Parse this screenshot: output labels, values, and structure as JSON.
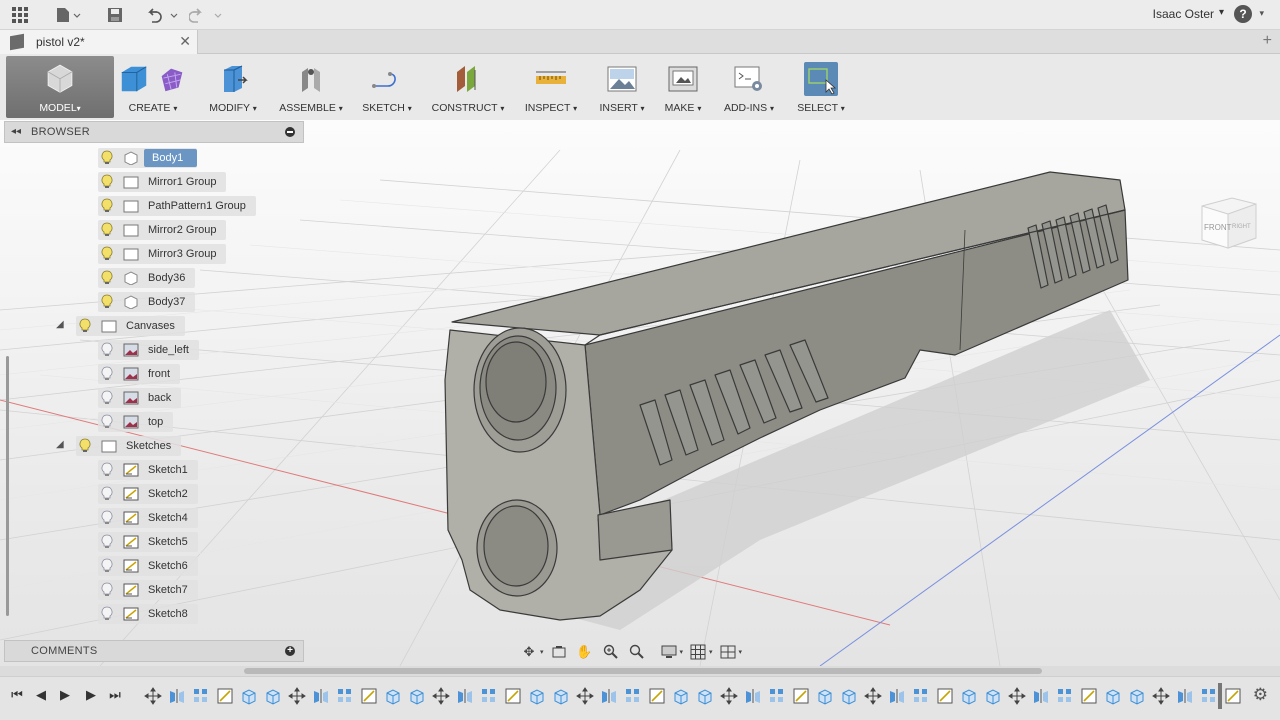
{
  "user": {
    "name": "Isaac Oster"
  },
  "document": {
    "tab_title": "pistol v2*"
  },
  "toolbar": {
    "groups": [
      {
        "label": "MODEL"
      },
      {
        "label": "CREATE"
      },
      {
        "label": "MODIFY"
      },
      {
        "label": "ASSEMBLE"
      },
      {
        "label": "SKETCH"
      },
      {
        "label": "CONSTRUCT"
      },
      {
        "label": "INSPECT"
      },
      {
        "label": "INSERT"
      },
      {
        "label": "MAKE"
      },
      {
        "label": "ADD-INS"
      },
      {
        "label": "SELECT"
      }
    ],
    "dropdown_glyph": "▾"
  },
  "viewcube": {
    "front": "FRONT",
    "right": "RIGHT"
  },
  "browser": {
    "title": "BROWSER",
    "nodes": [
      {
        "label": "Body1",
        "icon": "body-icon",
        "selected": true
      },
      {
        "label": "Mirror1 Group",
        "icon": "folder-icon"
      },
      {
        "label": "PathPattern1 Group",
        "icon": "folder-icon"
      },
      {
        "label": "Mirror2 Group",
        "icon": "folder-icon"
      },
      {
        "label": "Mirror3 Group",
        "icon": "folder-icon"
      },
      {
        "label": "Body36",
        "icon": "body-icon"
      },
      {
        "label": "Body37",
        "icon": "body-icon"
      },
      {
        "label": "Canvases",
        "icon": "folder-icon",
        "expander": "◢"
      },
      {
        "label": "side_left",
        "icon": "canvas-icon"
      },
      {
        "label": "front",
        "icon": "canvas-icon"
      },
      {
        "label": "back",
        "icon": "canvas-icon"
      },
      {
        "label": "top",
        "icon": "canvas-icon"
      },
      {
        "label": "Sketches",
        "icon": "folder-icon",
        "expander": "◢"
      },
      {
        "label": "Sketch1",
        "icon": "sketch-icon"
      },
      {
        "label": "Sketch2",
        "icon": "sketch-icon"
      },
      {
        "label": "Sketch4",
        "icon": "sketch-icon"
      },
      {
        "label": "Sketch5",
        "icon": "sketch-icon"
      },
      {
        "label": "Sketch6",
        "icon": "sketch-icon"
      },
      {
        "label": "Sketch7",
        "icon": "sketch-icon"
      },
      {
        "label": "Sketch8",
        "icon": "sketch-icon"
      }
    ]
  },
  "comments": {
    "title": "COMMENTS"
  },
  "colors": {
    "selected_row": "#6b96c4",
    "model_workspace": "#7a7a7a",
    "select_active": "#5a8ab5",
    "grid_axis_red": "#e07a7a",
    "grid_axis_blue": "#7a90e0",
    "model_body": "#9a9a92"
  }
}
